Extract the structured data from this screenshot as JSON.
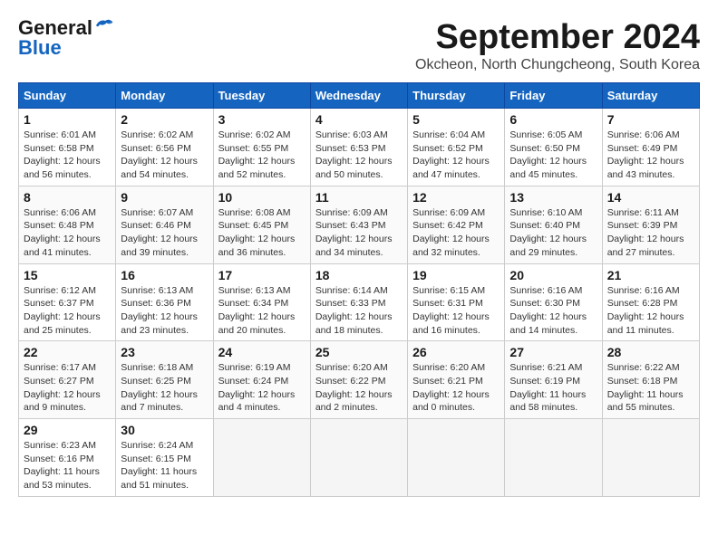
{
  "header": {
    "logo_general": "General",
    "logo_blue": "Blue",
    "month_year": "September 2024",
    "location": "Okcheon, North Chungcheong, South Korea"
  },
  "calendar": {
    "days_of_week": [
      "Sunday",
      "Monday",
      "Tuesday",
      "Wednesday",
      "Thursday",
      "Friday",
      "Saturday"
    ],
    "weeks": [
      [
        {
          "day": "1",
          "sunrise": "6:01 AM",
          "sunset": "6:58 PM",
          "daylight": "12 hours and 56 minutes."
        },
        {
          "day": "2",
          "sunrise": "6:02 AM",
          "sunset": "6:56 PM",
          "daylight": "12 hours and 54 minutes."
        },
        {
          "day": "3",
          "sunrise": "6:02 AM",
          "sunset": "6:55 PM",
          "daylight": "12 hours and 52 minutes."
        },
        {
          "day": "4",
          "sunrise": "6:03 AM",
          "sunset": "6:53 PM",
          "daylight": "12 hours and 50 minutes."
        },
        {
          "day": "5",
          "sunrise": "6:04 AM",
          "sunset": "6:52 PM",
          "daylight": "12 hours and 47 minutes."
        },
        {
          "day": "6",
          "sunrise": "6:05 AM",
          "sunset": "6:50 PM",
          "daylight": "12 hours and 45 minutes."
        },
        {
          "day": "7",
          "sunrise": "6:06 AM",
          "sunset": "6:49 PM",
          "daylight": "12 hours and 43 minutes."
        }
      ],
      [
        {
          "day": "8",
          "sunrise": "6:06 AM",
          "sunset": "6:48 PM",
          "daylight": "12 hours and 41 minutes."
        },
        {
          "day": "9",
          "sunrise": "6:07 AM",
          "sunset": "6:46 PM",
          "daylight": "12 hours and 39 minutes."
        },
        {
          "day": "10",
          "sunrise": "6:08 AM",
          "sunset": "6:45 PM",
          "daylight": "12 hours and 36 minutes."
        },
        {
          "day": "11",
          "sunrise": "6:09 AM",
          "sunset": "6:43 PM",
          "daylight": "12 hours and 34 minutes."
        },
        {
          "day": "12",
          "sunrise": "6:09 AM",
          "sunset": "6:42 PM",
          "daylight": "12 hours and 32 minutes."
        },
        {
          "day": "13",
          "sunrise": "6:10 AM",
          "sunset": "6:40 PM",
          "daylight": "12 hours and 29 minutes."
        },
        {
          "day": "14",
          "sunrise": "6:11 AM",
          "sunset": "6:39 PM",
          "daylight": "12 hours and 27 minutes."
        }
      ],
      [
        {
          "day": "15",
          "sunrise": "6:12 AM",
          "sunset": "6:37 PM",
          "daylight": "12 hours and 25 minutes."
        },
        {
          "day": "16",
          "sunrise": "6:13 AM",
          "sunset": "6:36 PM",
          "daylight": "12 hours and 23 minutes."
        },
        {
          "day": "17",
          "sunrise": "6:13 AM",
          "sunset": "6:34 PM",
          "daylight": "12 hours and 20 minutes."
        },
        {
          "day": "18",
          "sunrise": "6:14 AM",
          "sunset": "6:33 PM",
          "daylight": "12 hours and 18 minutes."
        },
        {
          "day": "19",
          "sunrise": "6:15 AM",
          "sunset": "6:31 PM",
          "daylight": "12 hours and 16 minutes."
        },
        {
          "day": "20",
          "sunrise": "6:16 AM",
          "sunset": "6:30 PM",
          "daylight": "12 hours and 14 minutes."
        },
        {
          "day": "21",
          "sunrise": "6:16 AM",
          "sunset": "6:28 PM",
          "daylight": "12 hours and 11 minutes."
        }
      ],
      [
        {
          "day": "22",
          "sunrise": "6:17 AM",
          "sunset": "6:27 PM",
          "daylight": "12 hours and 9 minutes."
        },
        {
          "day": "23",
          "sunrise": "6:18 AM",
          "sunset": "6:25 PM",
          "daylight": "12 hours and 7 minutes."
        },
        {
          "day": "24",
          "sunrise": "6:19 AM",
          "sunset": "6:24 PM",
          "daylight": "12 hours and 4 minutes."
        },
        {
          "day": "25",
          "sunrise": "6:20 AM",
          "sunset": "6:22 PM",
          "daylight": "12 hours and 2 minutes."
        },
        {
          "day": "26",
          "sunrise": "6:20 AM",
          "sunset": "6:21 PM",
          "daylight": "12 hours and 0 minutes."
        },
        {
          "day": "27",
          "sunrise": "6:21 AM",
          "sunset": "6:19 PM",
          "daylight": "11 hours and 58 minutes."
        },
        {
          "day": "28",
          "sunrise": "6:22 AM",
          "sunset": "6:18 PM",
          "daylight": "11 hours and 55 minutes."
        }
      ],
      [
        {
          "day": "29",
          "sunrise": "6:23 AM",
          "sunset": "6:16 PM",
          "daylight": "11 hours and 53 minutes."
        },
        {
          "day": "30",
          "sunrise": "6:24 AM",
          "sunset": "6:15 PM",
          "daylight": "11 hours and 51 minutes."
        },
        null,
        null,
        null,
        null,
        null
      ]
    ]
  }
}
